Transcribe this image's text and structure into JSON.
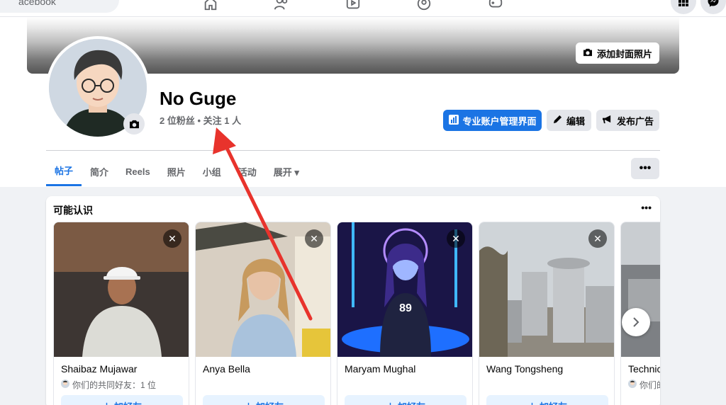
{
  "topbar": {
    "search_text": "acebook",
    "nav_icons": [
      "home-icon",
      "friends-icon",
      "video-icon",
      "groups-icon",
      "gaming-icon"
    ],
    "right_icons": [
      "apps-grid-icon",
      "messenger-icon"
    ]
  },
  "profile": {
    "add_cover_label": "添加封面照片",
    "name": "No Guge",
    "followers_text": "2 位粉丝 • 关注 1 人",
    "pro_dashboard_label": "专业账户管理界面",
    "edit_label": "编辑",
    "advertise_label": "发布广告"
  },
  "tabs": [
    {
      "label": "帖子",
      "active": true
    },
    {
      "label": "简介"
    },
    {
      "label": "Reels"
    },
    {
      "label": "照片"
    },
    {
      "label": "小组"
    },
    {
      "label": "活动"
    },
    {
      "label": "展开 ▾"
    }
  ],
  "more_label": "•••",
  "pymk": {
    "title": "可能认识",
    "more_label": "•••",
    "add_label": "加好友",
    "people": [
      {
        "name": "Shaibaz Mujawar",
        "mutual": "你们的共同好友：1 位"
      },
      {
        "name": "Anya Bella",
        "mutual": ""
      },
      {
        "name": "Maryam Mughal",
        "mutual": ""
      },
      {
        "name": "Wang Tongsheng",
        "mutual": ""
      },
      {
        "name": "Technic",
        "mutual": "你们的"
      }
    ]
  },
  "colors": {
    "accent": "#1b74e4",
    "annotation_arrow": "#e8332c"
  }
}
